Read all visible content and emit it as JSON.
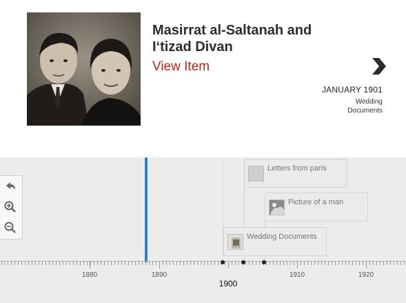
{
  "detail": {
    "title_line1": "Masirrat al-Saltanah and",
    "title_line2": "I‘tizad Divan",
    "view_item_label": "View Item",
    "date": "JANUARY 1901",
    "tags": [
      "Wedding",
      "Documents"
    ],
    "next_icon": "chevron-right-icon"
  },
  "controls": {
    "items": [
      {
        "icon": "back-arrow-icon"
      },
      {
        "icon": "zoom-in-icon"
      },
      {
        "icon": "zoom-out-icon"
      }
    ]
  },
  "timeline": {
    "events": [
      {
        "label": "Letters from paris"
      },
      {
        "label": "Picture of a man"
      },
      {
        "label": "Wedding Documents"
      }
    ],
    "years": [
      "1880",
      "1890",
      "1900",
      "1910",
      "1920"
    ],
    "current_year": "1900"
  },
  "colors": {
    "accent_red": "#b7261a",
    "focus_blue": "#2f80c5",
    "band_gray": "#ececec"
  }
}
